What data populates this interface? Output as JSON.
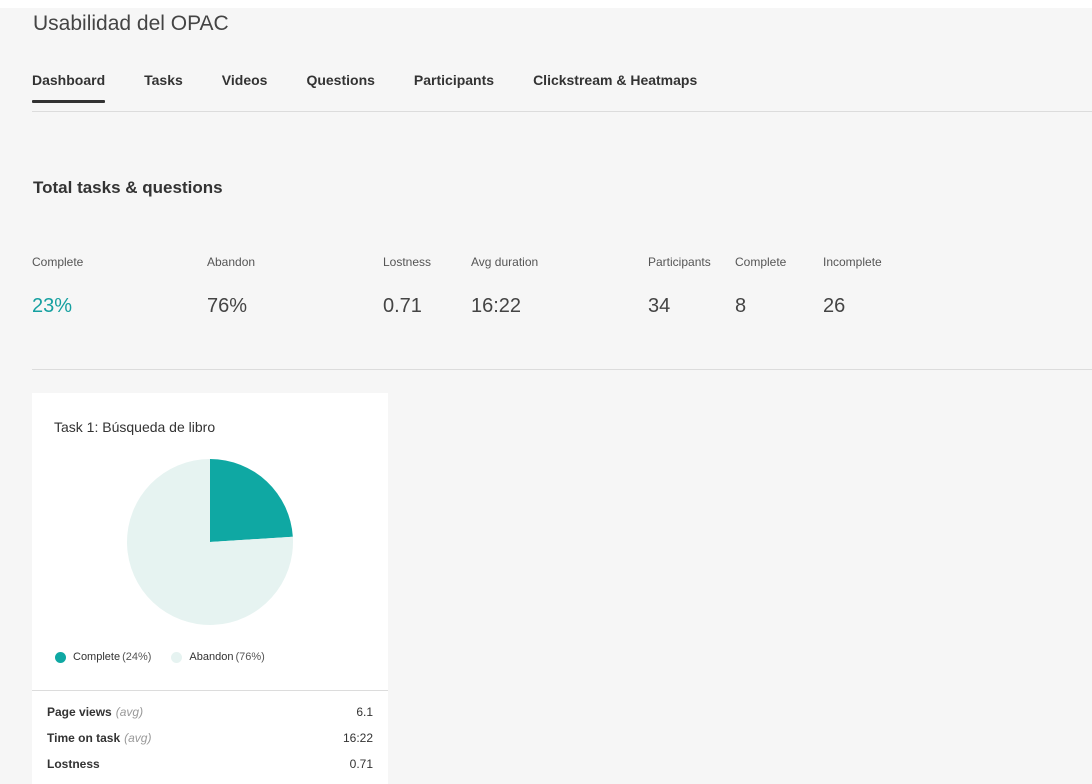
{
  "page": {
    "title": "Usabilidad del OPAC"
  },
  "tabs": [
    {
      "label": "Dashboard"
    },
    {
      "label": "Tasks"
    },
    {
      "label": "Videos"
    },
    {
      "label": "Questions"
    },
    {
      "label": "Participants"
    },
    {
      "label": "Clickstream & Heatmaps"
    }
  ],
  "summary": {
    "title": "Total tasks & questions",
    "metrics": [
      {
        "label": "Complete",
        "value": "23%"
      },
      {
        "label": "Abandon",
        "value": "76%"
      },
      {
        "label": "Lostness",
        "value": "0.71"
      },
      {
        "label": "Avg duration",
        "value": "16:22"
      },
      {
        "label": "Participants",
        "value": "34"
      },
      {
        "label": "Complete",
        "value": "8"
      },
      {
        "label": "Incomplete",
        "value": "26"
      }
    ]
  },
  "task_card": {
    "title": "Task 1: Búsqueda de libro",
    "legend": [
      {
        "label": "Complete",
        "pct": "(24%)"
      },
      {
        "label": "Abandon",
        "pct": "(76%)"
      }
    ],
    "stats": [
      {
        "label": "Page views",
        "unit": "(avg)",
        "value": "6.1"
      },
      {
        "label": "Time on task",
        "unit": "(avg)",
        "value": "16:22"
      },
      {
        "label": "Lostness",
        "unit": "",
        "value": "0.71"
      }
    ]
  },
  "chart_data": {
    "type": "pie",
    "categories": [
      "Complete",
      "Abandon"
    ],
    "values": [
      24,
      76
    ],
    "colors": [
      "#0fa8a3",
      "#e6f3f1"
    ]
  },
  "colors": {
    "accent": "#15a0a0",
    "pie_complete": "#0fa8a3",
    "pie_abandon": "#e6f3f1"
  }
}
